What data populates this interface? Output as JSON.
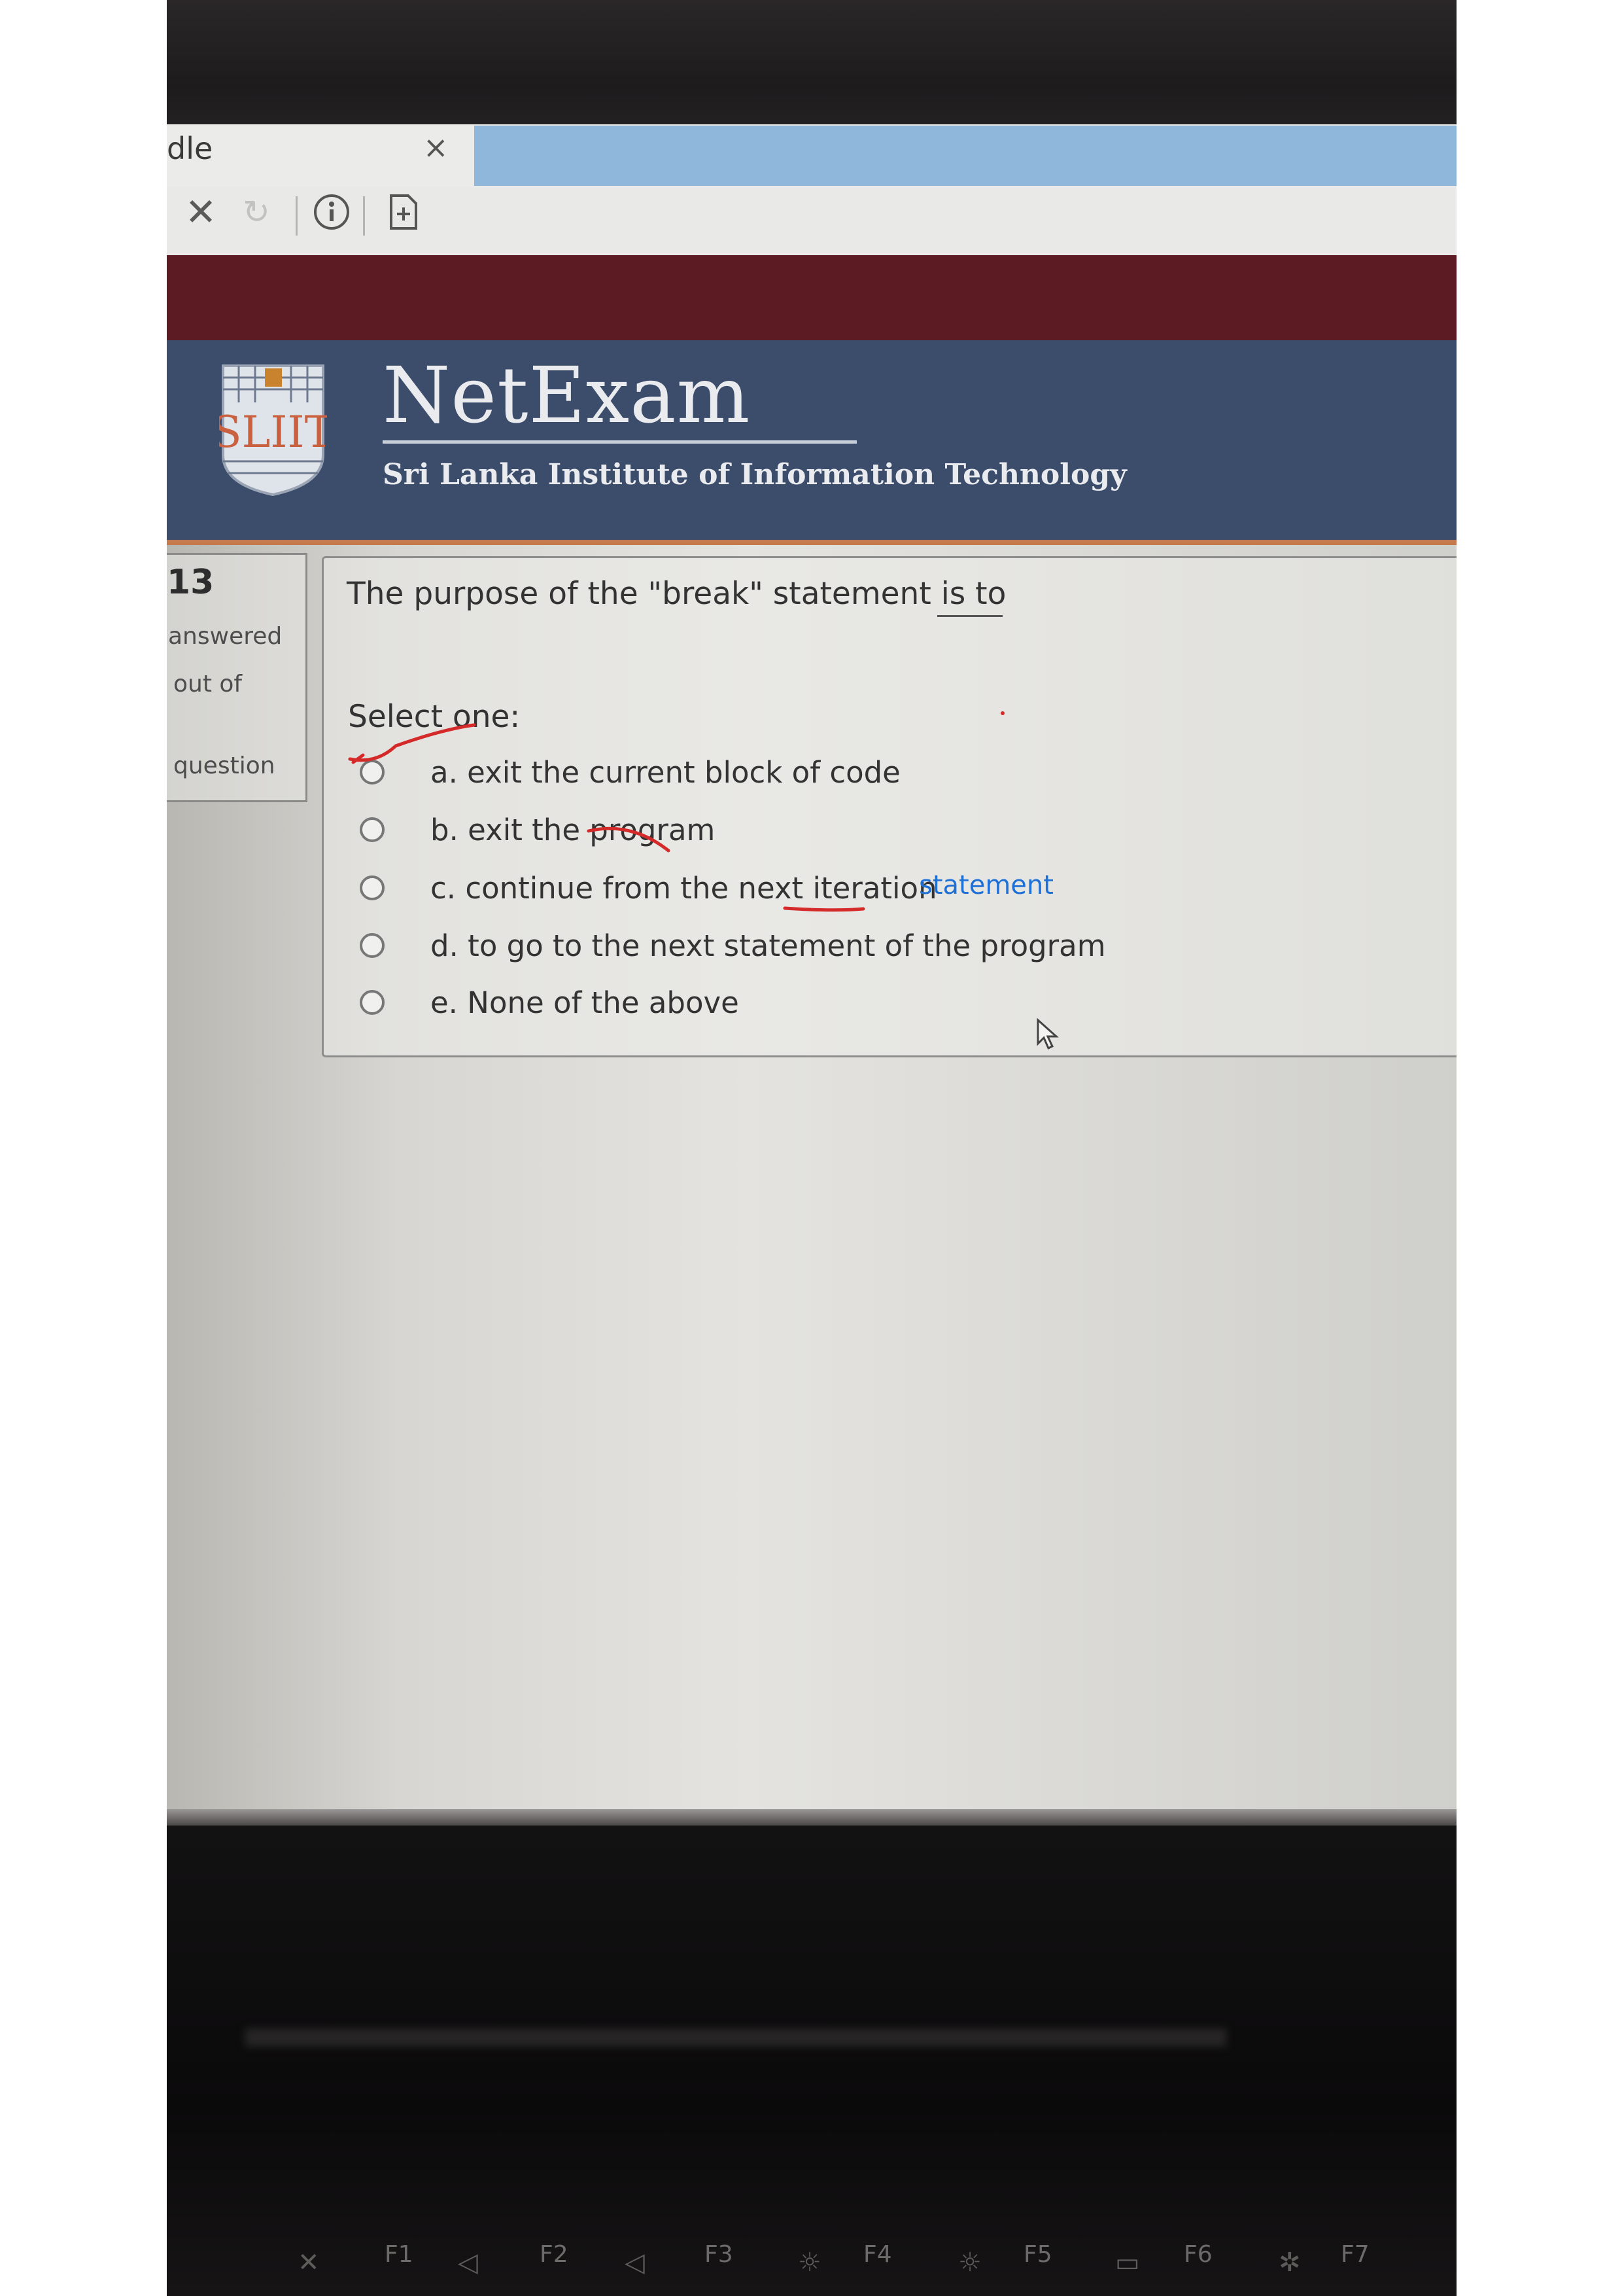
{
  "browser": {
    "tab_title": "dle",
    "tab_close": "×",
    "toolbar_icons": [
      "stop-icon",
      "reload-icon",
      "info-icon",
      "page-icon"
    ]
  },
  "header": {
    "logo_text": "SLIIT",
    "title": "NetExam",
    "subtitle": "Sri Lanka Institute of Information Technology",
    "colors": {
      "header_bg": "#3c4c6b",
      "maroon_band": "#5c1a22",
      "accent_rule": "#c47a4c"
    }
  },
  "question_info": {
    "number": "13",
    "status": "answered",
    "marks": "out of",
    "flag": "question"
  },
  "question": {
    "text": "The purpose of the \"break\" statement is to",
    "prompt": "Select one:",
    "options": [
      {
        "label": "a. exit the current block of code"
      },
      {
        "label": "b. exit the program"
      },
      {
        "label": "c. continue from the next iteration"
      },
      {
        "label": "d. to go to the next statement of the program"
      },
      {
        "label": "e. None of the above"
      }
    ],
    "annotation": "statement"
  },
  "keyboard": {
    "fkeys": [
      "F1",
      "F2",
      "F3",
      "F4",
      "F5",
      "F6",
      "F7"
    ]
  }
}
